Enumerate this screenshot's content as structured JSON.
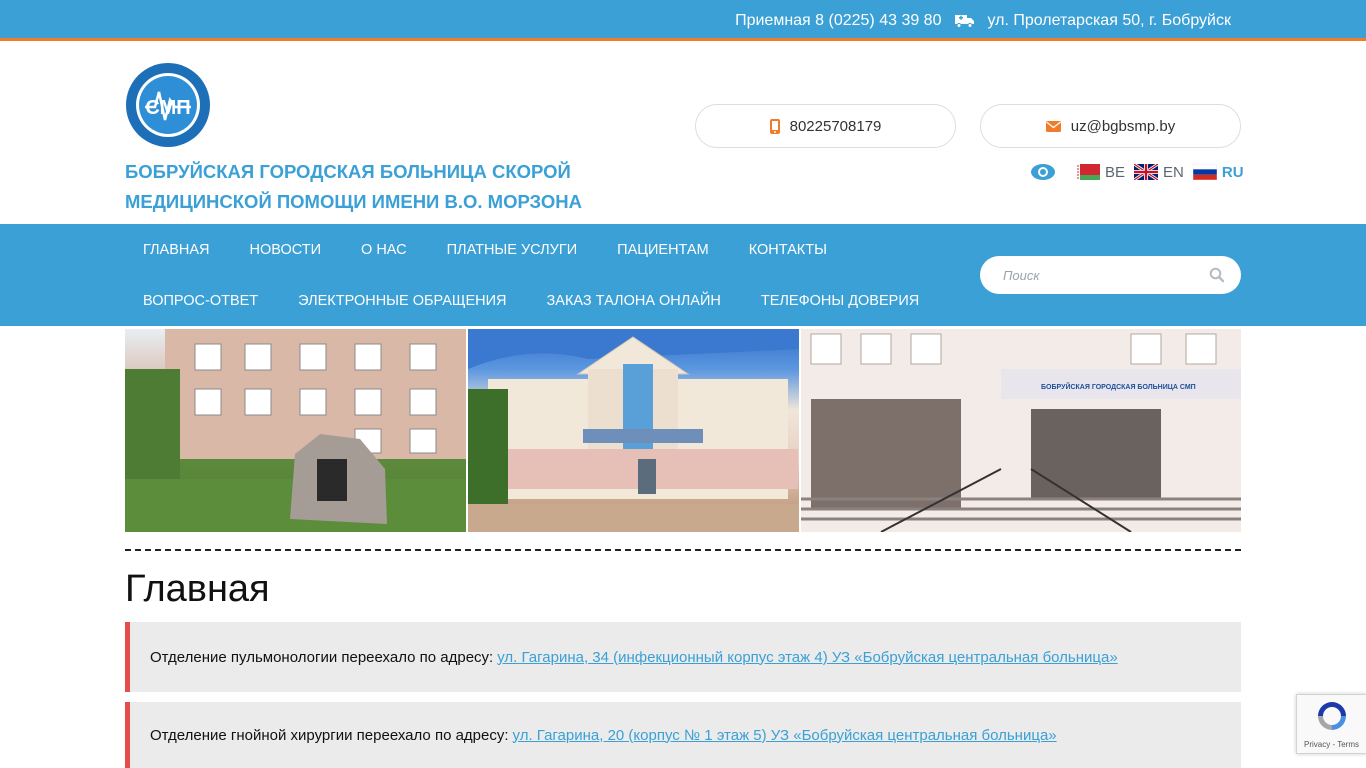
{
  "topbar": {
    "reception": "Приемная 8 (0225) 43 39 80",
    "address_icon": "truck-icon",
    "address": "ул. Пролетарская 50, г. Бобруйск"
  },
  "header": {
    "logo_icon": "smp-logo-icon",
    "logo_text": "СМП",
    "org_name": "БОБРУЙСКАЯ ГОРОДСКАЯ БОЛЬНИЦА СКОРОЙ МЕДИЦИНСКОЙ ПОМОЩИ ИМЕНИ В.О. МОРЗОНА",
    "phone": "80225708179",
    "email": "uz@bgbsmp.by",
    "languages": [
      {
        "code": "BE",
        "active": false
      },
      {
        "code": "EN",
        "active": false
      },
      {
        "code": "RU",
        "active": true
      }
    ]
  },
  "nav": {
    "row1": [
      "ГЛАВНАЯ",
      "НОВОСТИ",
      "О НАС",
      "ПЛАТНЫЕ УСЛУГИ",
      "ПАЦИЕНТАМ",
      "КОНТАКТЫ"
    ],
    "row2": [
      "ВОПРОС-ОТВЕТ",
      "ЭЛЕКТРОННЫЕ ОБРАЩЕНИЯ",
      "ЗАКАЗ ТАЛОНА ОНЛАЙН",
      "ТЕЛЕФОНЫ ДОВЕРИЯ"
    ],
    "search_placeholder": "Поиск"
  },
  "banner": {
    "sign_text": "БОБРУЙСКАЯ ГОРОДСКАЯ БОЛЬНИЦА СМП"
  },
  "main": {
    "title": "Главная",
    "notices": [
      {
        "text": "Отделение пульмонологии переехало по адресу:",
        "link": "ул. Гагарина, 34 (инфекционный корпус этаж 4) УЗ «Бобруйская центральная больница»"
      },
      {
        "text": "Отделение гнойной хирургии переехало по адресу:",
        "link": "ул. Гагарина, 20  (корпус № 1 этаж 5) УЗ «Бобруйская центральная больница»"
      }
    ]
  },
  "recaptcha": {
    "terms": "Privacy - Terms"
  },
  "colors": {
    "brand": "#3aa0d5",
    "accent": "#f07b28",
    "alert": "#e74c4c"
  }
}
